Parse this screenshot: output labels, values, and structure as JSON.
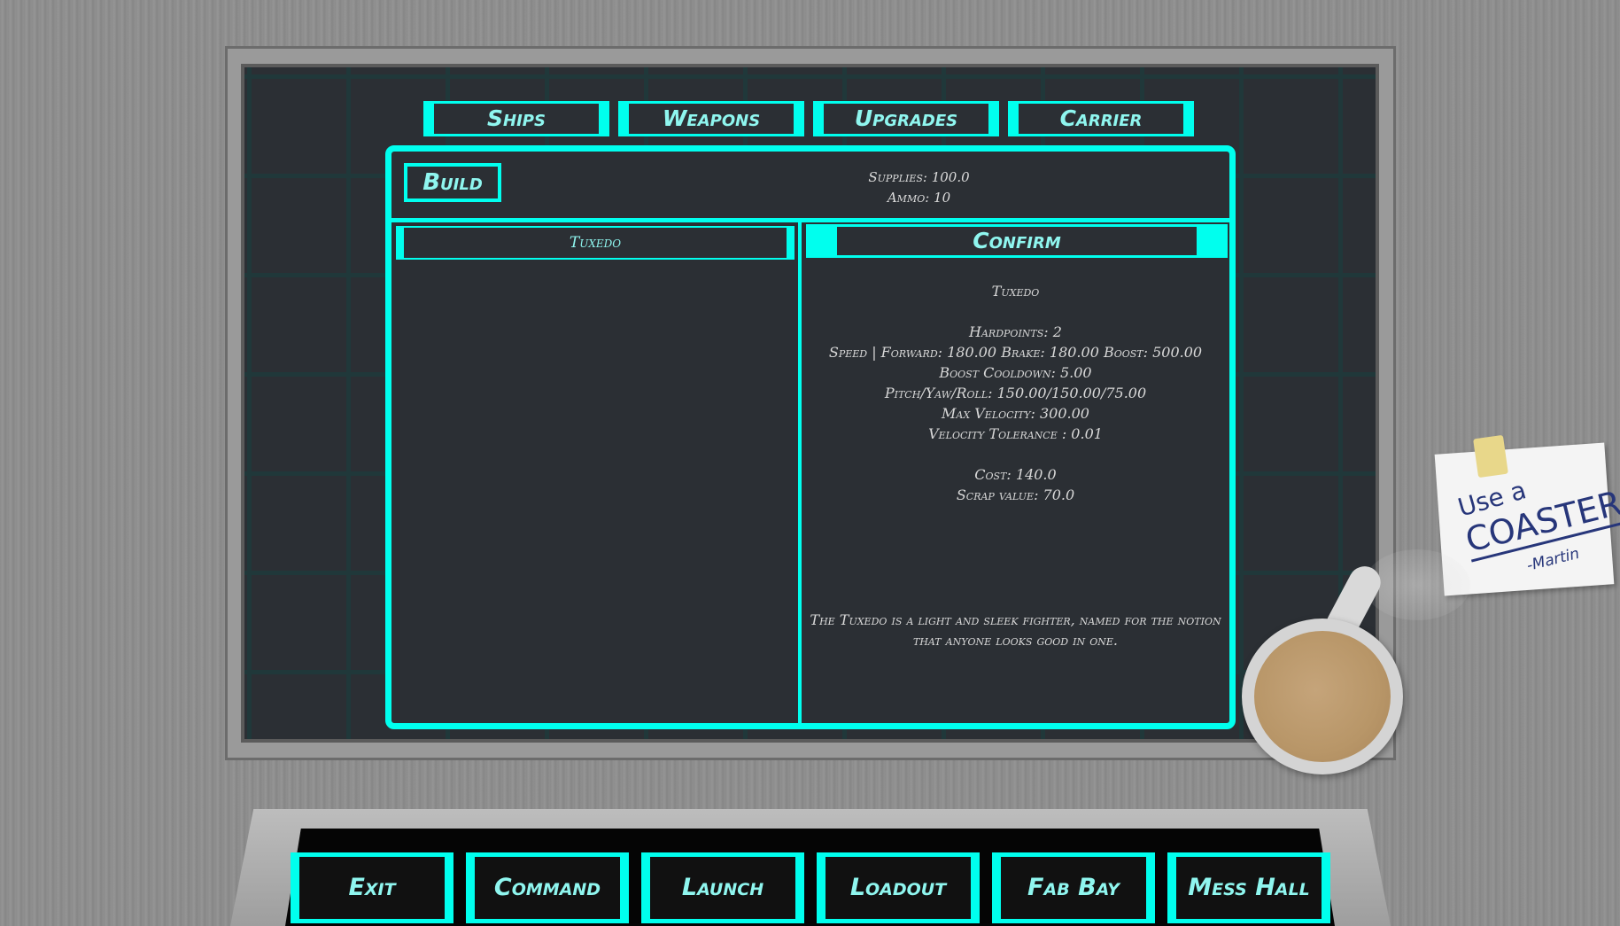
{
  "tabs": [
    {
      "label": "Ships"
    },
    {
      "label": "Weapons"
    },
    {
      "label": "Upgrades"
    },
    {
      "label": "Carrier"
    }
  ],
  "panel": {
    "build_label": "Build",
    "supplies": "Supplies: 100.0",
    "ammo": "Ammo: 10",
    "ship_list": [
      {
        "name": "Tuxedo"
      }
    ],
    "confirm_label": "Confirm"
  },
  "details": {
    "name": "Tuxedo",
    "hardpoints": "Hardpoints: 2",
    "speed": "Speed | Forward: 180.00 Brake: 180.00 Boost: 500.00",
    "boost_cooldown": "Boost Cooldown: 5.00",
    "pitch_yaw_roll": "Pitch/Yaw/Roll: 150.00/150.00/75.00",
    "max_velocity": "Max Velocity: 300.00",
    "velocity_tolerance": "Velocity Tolerance : 0.01",
    "cost": "Cost: 140.0",
    "scrap_value": "Scrap value: 70.0",
    "description": "The Tuxedo is a light and sleek fighter, named for the notion that anyone looks good in one."
  },
  "note": {
    "line1": "Use a",
    "line2": "COASTER",
    "signature": "-Martin"
  },
  "nav": [
    {
      "label": "Exit"
    },
    {
      "label": "Command"
    },
    {
      "label": "Launch"
    },
    {
      "label": "Loadout"
    },
    {
      "label": "Fab Bay"
    },
    {
      "label": "Mess Hall"
    }
  ],
  "colors": {
    "accent": "#00ffee",
    "accent_text": "#8ff6ef",
    "screen_bg": "#2b2f34"
  }
}
